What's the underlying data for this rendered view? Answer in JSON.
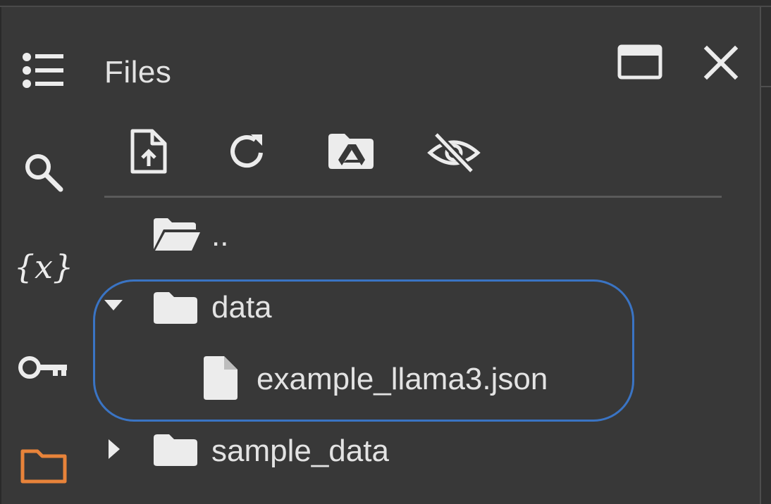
{
  "panel": {
    "title": "Files"
  },
  "sidebar": {
    "items": [
      {
        "icon": "table-of-contents-icon",
        "label": "Table of contents"
      },
      {
        "icon": "search-icon",
        "label": "Find and replace"
      },
      {
        "icon": "variables-icon",
        "label": "Variables"
      },
      {
        "icon": "key-icon",
        "label": "Secrets"
      },
      {
        "icon": "folder-icon",
        "label": "Files",
        "active": true
      }
    ],
    "active_color": "#e8833a"
  },
  "toolbar": {
    "buttons": [
      {
        "icon": "upload-file-icon"
      },
      {
        "icon": "refresh-icon"
      },
      {
        "icon": "mount-drive-icon"
      },
      {
        "icon": "hide-hidden-files-icon"
      }
    ]
  },
  "header_actions": [
    {
      "icon": "open-in-tab-icon"
    },
    {
      "icon": "close-icon"
    }
  ],
  "tree": {
    "parent": {
      "label": ".."
    },
    "items": [
      {
        "name": "data",
        "type": "folder",
        "expanded": true
      },
      {
        "name": "example_llama3.json",
        "type": "file",
        "parent": "data"
      },
      {
        "name": "sample_data",
        "type": "folder",
        "expanded": false
      }
    ]
  },
  "colors": {
    "background": "#383838",
    "text": "#e3e3e3",
    "selection_outline": "#3a74c4"
  }
}
